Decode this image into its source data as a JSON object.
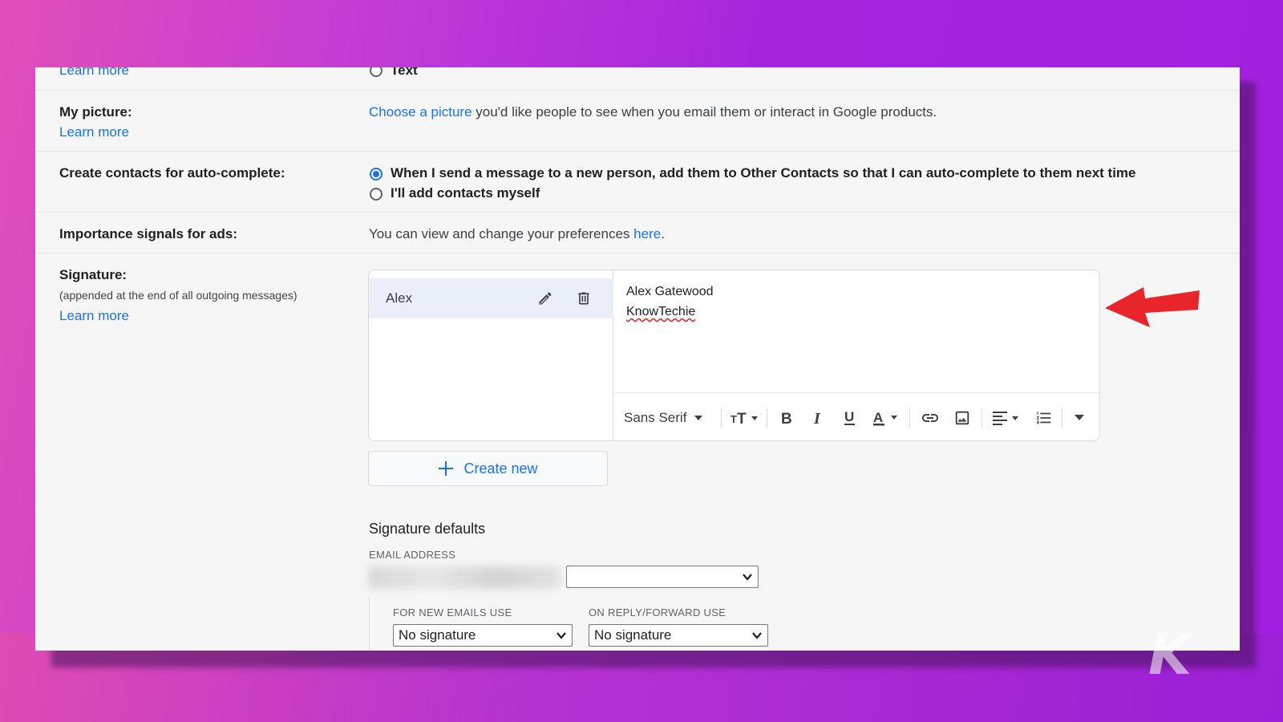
{
  "top_row": {
    "learn_more": "Learn more",
    "text_option": "Text"
  },
  "my_picture": {
    "label": "My picture:",
    "learn_more": "Learn more",
    "link_text": "Choose a picture",
    "rest_text": " you'd like people to see when you email them or interact in Google products."
  },
  "contacts": {
    "label": "Create contacts for auto-complete:",
    "option_1": "When I send a message to a new person, add them to Other Contacts so that I can auto-complete to them next time",
    "option_2": "I'll add contacts myself",
    "selected": "option_1"
  },
  "ads": {
    "label": "Importance signals for ads:",
    "text_before": "You can view and change your preferences ",
    "link_text": "here",
    "text_after": "."
  },
  "signature": {
    "label": "Signature:",
    "description": "(appended at the end of all outgoing messages)",
    "learn_more": "Learn more",
    "items": [
      {
        "name": "Alex"
      }
    ],
    "editor_lines": [
      "Alex Gatewood",
      "KnowTechie"
    ],
    "toolbar": {
      "font": "Sans Serif",
      "icons": [
        "font-size-icon",
        "bold-icon",
        "italic-icon",
        "underline-icon",
        "text-color-icon",
        "link-icon",
        "image-icon",
        "align-icon",
        "numbered-list-icon",
        "more-formatting-icon"
      ]
    },
    "create_new": "Create new"
  },
  "defaults": {
    "title": "Signature defaults",
    "email_label": "EMAIL ADDRESS",
    "new_emails_label": "FOR NEW EMAILS USE",
    "new_emails_value": "No signature",
    "reply_label": "ON REPLY/FORWARD USE",
    "reply_value": "No signature"
  },
  "colors": {
    "link": "#1a73e8",
    "selected_item": "#e9eef8",
    "annotation_arrow": "#e8252b",
    "background_gradient": [
      "#e04fb8",
      "#a31fe0"
    ]
  },
  "watermark": "K"
}
